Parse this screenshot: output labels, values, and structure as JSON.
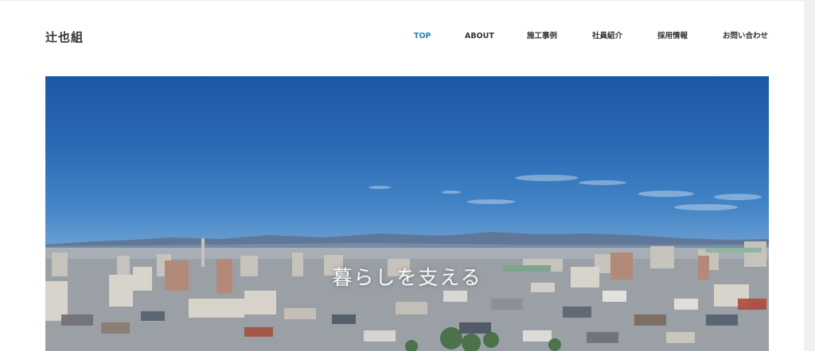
{
  "site": {
    "logo": "辻也組"
  },
  "nav": {
    "items": [
      {
        "label": "TOP",
        "active": true
      },
      {
        "label": "ABOUT",
        "active": false
      },
      {
        "label": "施工事例",
        "active": false
      },
      {
        "label": "社員紹介",
        "active": false
      },
      {
        "label": "採用情報",
        "active": false
      },
      {
        "label": "お問い合わせ",
        "active": false
      }
    ]
  },
  "hero": {
    "tagline": "暮らしを支える"
  },
  "colors": {
    "nav_active": "#2f7fb3",
    "text": "#333333",
    "sky": "#1c58a6"
  }
}
